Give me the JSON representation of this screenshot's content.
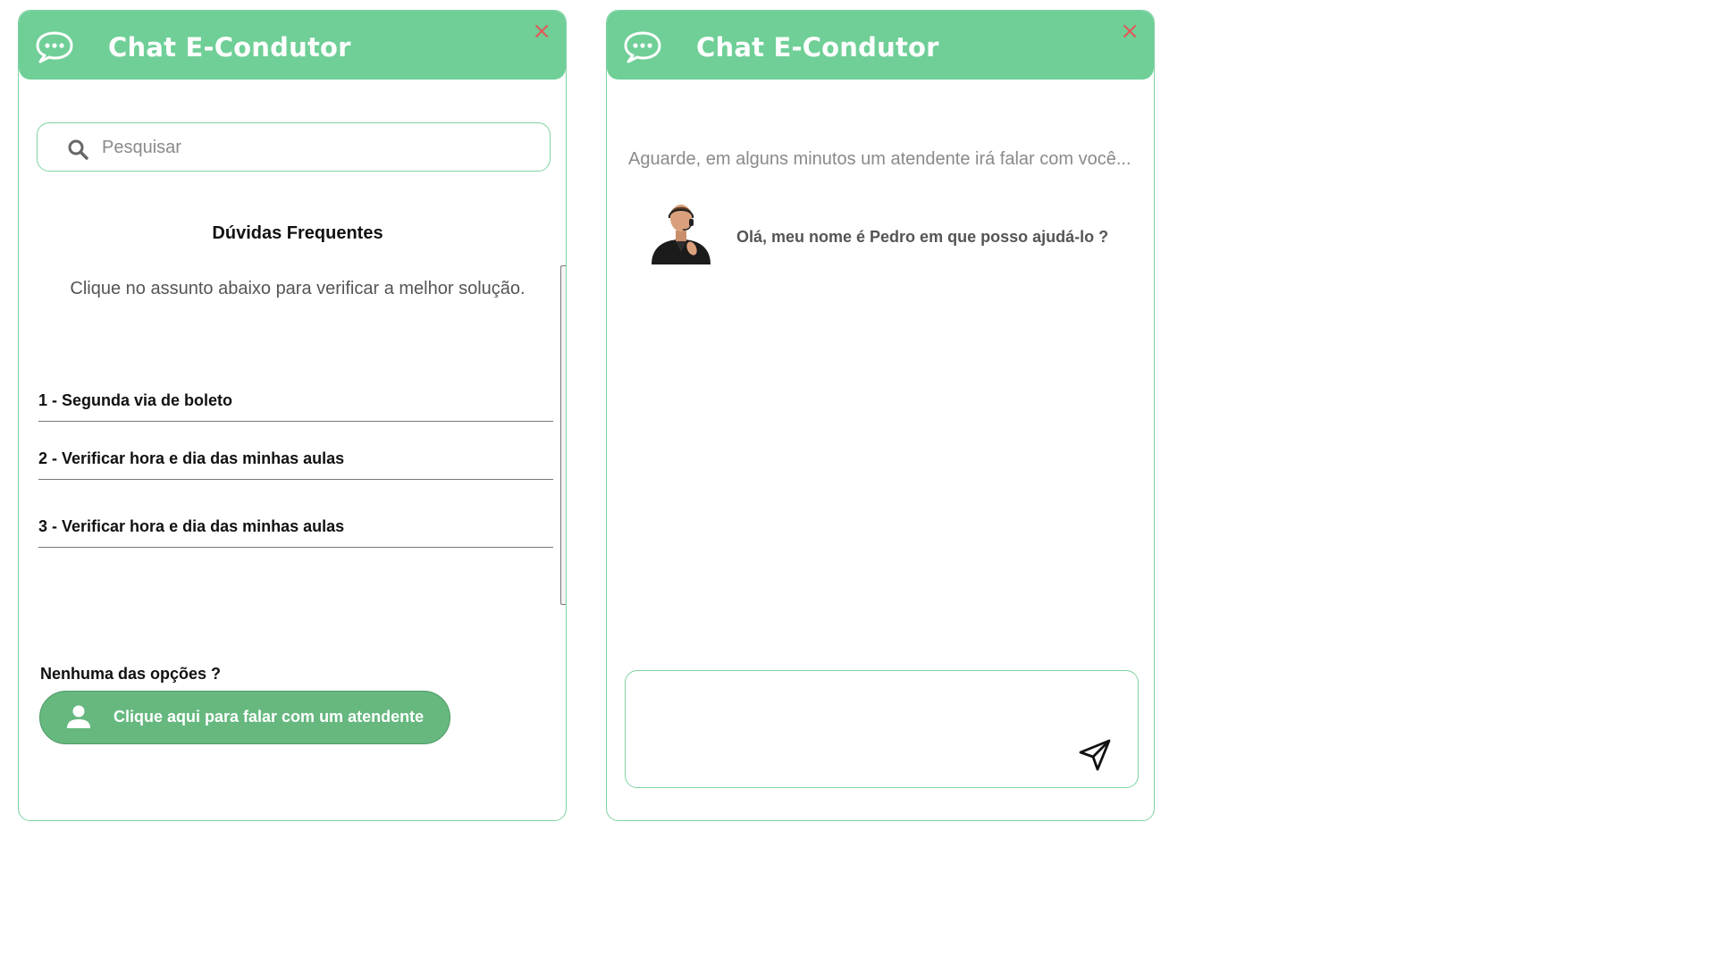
{
  "faq_panel": {
    "title": "Chat E-Condutor",
    "close_label": "×",
    "search": {
      "placeholder": "Pesquisar"
    },
    "faq_title": "Dúvidas Frequentes",
    "faq_subtitle": "Clique no assunto abaixo para verificar a melhor solução.",
    "items": [
      {
        "label": "1 - Segunda via de boleto"
      },
      {
        "label": "2 - Verificar hora e dia das minhas aulas"
      },
      {
        "label": "3 - Verificar hora e dia das minhas aulas"
      }
    ],
    "none_label": "Nenhuma das opções ?",
    "agent_button_label": "Clique aqui para falar com um atendente"
  },
  "chat_panel": {
    "title": "Chat E-Condutor",
    "close_label": "×",
    "wait_text": "Aguarde, em alguns minutos um atendente irá falar com você...",
    "agent_message": "Olá, meu nome é Pedro em que posso ajudá-lo ?",
    "message_input": {
      "value": ""
    }
  },
  "colors": {
    "accent": "#6fcf97",
    "button": "#66b87f",
    "border": "#7fd3a2",
    "close": "#e05a5a"
  },
  "icons": [
    "chat-bubble-icon",
    "close-icon",
    "search-icon",
    "user-icon",
    "agent-avatar",
    "send-icon"
  ]
}
